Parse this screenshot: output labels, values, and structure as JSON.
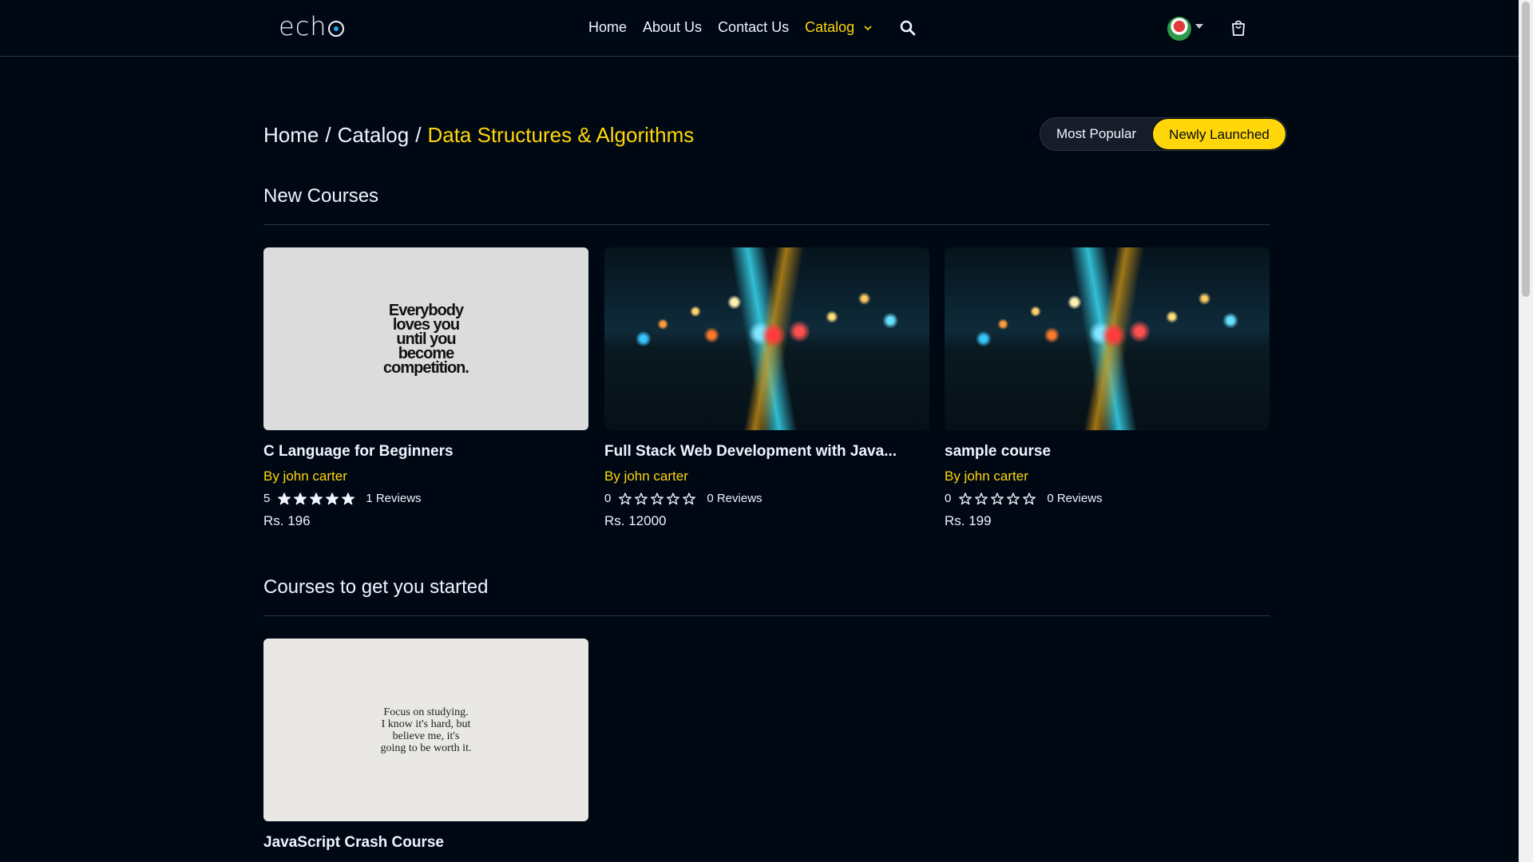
{
  "header": {
    "logo_prefix": "ech",
    "nav": [
      {
        "label": "Home"
      },
      {
        "label": "About Us"
      },
      {
        "label": "Contact Us"
      },
      {
        "label": "Catalog"
      }
    ]
  },
  "breadcrumb": {
    "home": "Home",
    "sep1": "/",
    "catalog": "Catalog",
    "sep2": "/",
    "current": "Data Structures & Algorithms"
  },
  "filter": {
    "most_popular": "Most Popular",
    "newly_launched": "Newly Launched",
    "selected": "Newly Launched"
  },
  "sections": {
    "new_courses": "New Courses",
    "get_started": "Courses to get you started"
  },
  "courses": [
    {
      "thumb_text": "Everybody\nloves you\nuntil you\nbecome\ncompetition.",
      "name": "C Language for Beginners",
      "by": "By john carter",
      "rating": "5",
      "stars_filled": 5,
      "reviews": "1 Reviews",
      "price": "Rs. 196"
    },
    {
      "name": "Full Stack Web Development with Java...",
      "by": "By john carter",
      "rating": "0",
      "stars_filled": 0,
      "reviews": "0 Reviews",
      "price": "Rs. 12000"
    },
    {
      "name": "sample course",
      "by": "By john carter",
      "rating": "0",
      "stars_filled": 0,
      "reviews": "0 Reviews",
      "price": "Rs. 199"
    },
    {
      "thumb_text": "Focus on studying.\nI know it's hard, but\nbelieve me, it's\ngoing to be worth it.",
      "name": "JavaScript Crash Course"
    }
  ],
  "colors": {
    "background": "#000814",
    "accent": "#ffd60a",
    "text": "#f1f2ff"
  }
}
